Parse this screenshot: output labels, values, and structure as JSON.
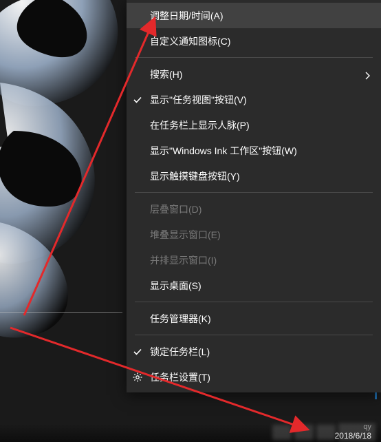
{
  "menu": {
    "items": [
      {
        "label": "调整日期/时间(A)",
        "checked": false,
        "has_submenu": false,
        "disabled": false,
        "hover": true,
        "icon": ""
      },
      {
        "label": "自定义通知图标(C)",
        "checked": false,
        "has_submenu": false,
        "disabled": false,
        "hover": false,
        "icon": ""
      },
      {
        "sep": true
      },
      {
        "label": "搜索(H)",
        "checked": false,
        "has_submenu": true,
        "disabled": false,
        "hover": false,
        "icon": ""
      },
      {
        "label": "显示\"任务视图\"按钮(V)",
        "checked": true,
        "has_submenu": false,
        "disabled": false,
        "hover": false,
        "icon": ""
      },
      {
        "label": "在任务栏上显示人脉(P)",
        "checked": false,
        "has_submenu": false,
        "disabled": false,
        "hover": false,
        "icon": ""
      },
      {
        "label": "显示\"Windows Ink 工作区\"按钮(W)",
        "checked": false,
        "has_submenu": false,
        "disabled": false,
        "hover": false,
        "icon": ""
      },
      {
        "label": "显示触摸键盘按钮(Y)",
        "checked": false,
        "has_submenu": false,
        "disabled": false,
        "hover": false,
        "icon": ""
      },
      {
        "sep": true
      },
      {
        "label": "层叠窗口(D)",
        "checked": false,
        "has_submenu": false,
        "disabled": true,
        "hover": false,
        "icon": ""
      },
      {
        "label": "堆叠显示窗口(E)",
        "checked": false,
        "has_submenu": false,
        "disabled": true,
        "hover": false,
        "icon": ""
      },
      {
        "label": "并排显示窗口(I)",
        "checked": false,
        "has_submenu": false,
        "disabled": true,
        "hover": false,
        "icon": ""
      },
      {
        "label": "显示桌面(S)",
        "checked": false,
        "has_submenu": false,
        "disabled": false,
        "hover": false,
        "icon": ""
      },
      {
        "sep": true
      },
      {
        "label": "任务管理器(K)",
        "checked": false,
        "has_submenu": false,
        "disabled": false,
        "hover": false,
        "icon": ""
      },
      {
        "sep": true
      },
      {
        "label": "锁定任务栏(L)",
        "checked": true,
        "has_submenu": false,
        "disabled": false,
        "hover": false,
        "icon": ""
      },
      {
        "label": "任务栏设置(T)",
        "checked": false,
        "has_submenu": false,
        "disabled": false,
        "hover": false,
        "icon": "gear"
      }
    ]
  },
  "tray": {
    "watermark": "qy",
    "date": "2018/6/18"
  }
}
